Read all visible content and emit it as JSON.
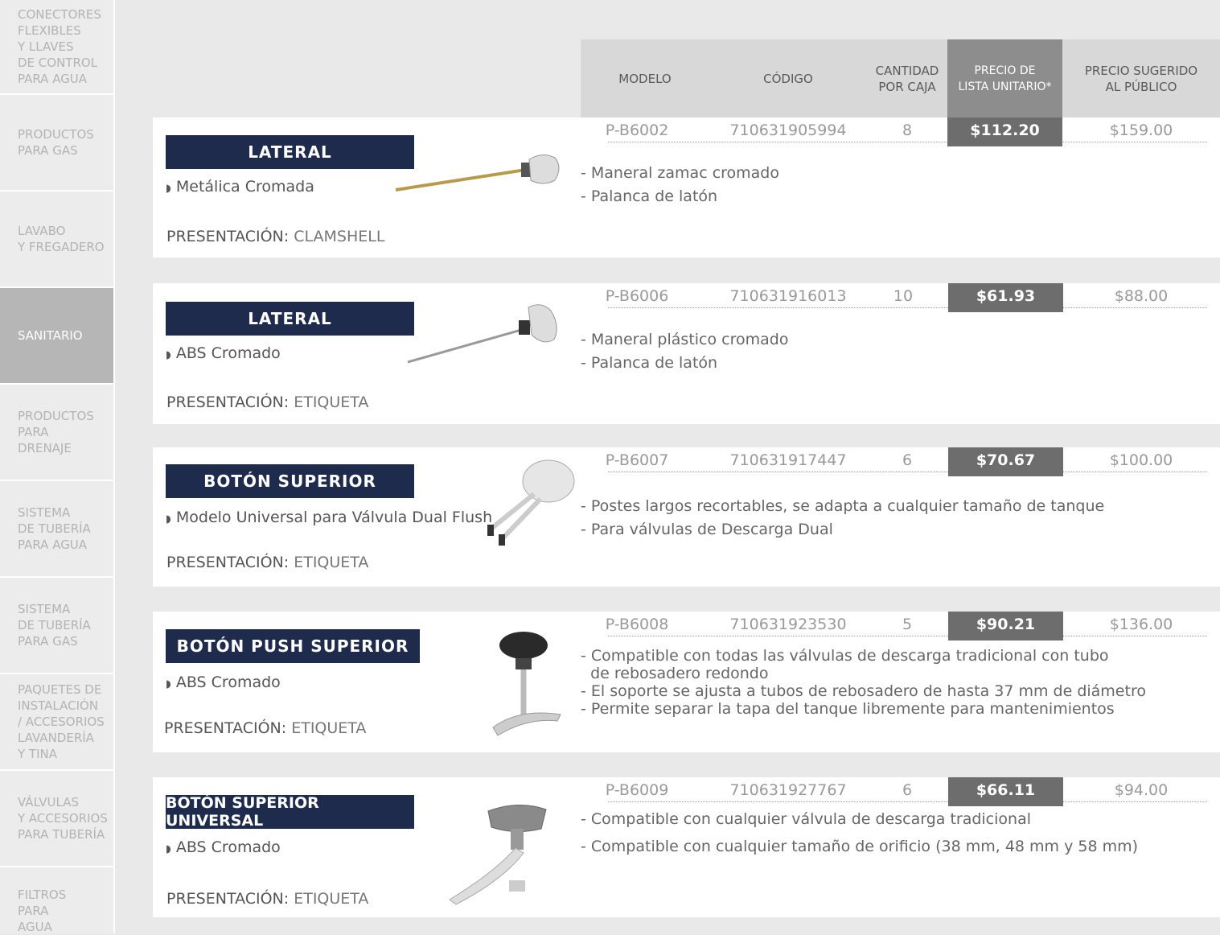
{
  "sidebar": {
    "items": [
      {
        "label": "CONECTORES\nFLEXIBLES\nY LLAVES\nDE CONTROL\nPARA AGUA",
        "active": false
      },
      {
        "label": "PRODUCTOS\nPARA GAS",
        "active": false
      },
      {
        "label": "LAVABO\nY FREGADERO",
        "active": false
      },
      {
        "label": "SANITARIO",
        "active": true
      },
      {
        "label": "PRODUCTOS\nPARA\nDRENAJE",
        "active": false
      },
      {
        "label": "SISTEMA\nDE TUBERÍA\nPARA AGUA",
        "active": false
      },
      {
        "label": "SISTEMA\nDE TUBERÍA\nPARA GAS",
        "active": false
      },
      {
        "label": "PAQUETES DE\nINSTALACIÓN\n/ ACCESORIOS\nLAVANDERÍA\nY TINA",
        "active": false
      },
      {
        "label": "VÁLVULAS\nY ACCESORIOS\nPARA TUBERÍA",
        "active": false
      },
      {
        "label": "FILTROS\nPARA\nAGUA",
        "active": false
      }
    ]
  },
  "table_header": {
    "modelo": "MODELO",
    "codigo": "CÓDIGO",
    "cantidad": "CANTIDAD\nPOR CAJA",
    "precio_lista": "PRECIO DE\nLISTA UNITARIO*",
    "precio_sugerido": "PRECIO SUGERIDO\nAL PÚBLICO"
  },
  "presentation_label": "PRESENTACIÓN: ",
  "products": [
    {
      "category": "LATERAL",
      "subtitle": "Metálica Cromada",
      "presentation": "CLAMSHELL",
      "modelo": "P-B6002",
      "codigo": "710631905994",
      "cantidad": "8",
      "precio_lista": "$112.20",
      "precio_sugerido": "$159.00",
      "features": "- Maneral zamac cromado\n- Palanca de latón"
    },
    {
      "category": "LATERAL",
      "subtitle": "ABS Cromado",
      "presentation": "ETIQUETA",
      "modelo": "P-B6006",
      "codigo": "710631916013",
      "cantidad": "10",
      "precio_lista": "$61.93",
      "precio_sugerido": "$88.00",
      "features": "- Maneral plástico cromado\n- Palanca de latón"
    },
    {
      "category": "BOTÓN SUPERIOR",
      "subtitle": "Modelo Universal para Válvula Dual Flush",
      "presentation": "ETIQUETA",
      "modelo": "P-B6007",
      "codigo": "710631917447",
      "cantidad": "6",
      "precio_lista": "$70.67",
      "precio_sugerido": "$100.00",
      "features": "- Postes largos recortables, se adapta a cualquier tamaño de tanque\n- Para válvulas de Descarga Dual"
    },
    {
      "category": "BOTÓN PUSH SUPERIOR",
      "subtitle": "ABS Cromado",
      "presentation": "ETIQUETA",
      "modelo": "P-B6008",
      "codigo": "710631923530",
      "cantidad": "5",
      "precio_lista": "$90.21",
      "precio_sugerido": "$136.00",
      "features": "- Compatible con todas las válvulas de descarga tradicional con tubo\n  de rebosadero redondo\n- El soporte se ajusta a tubos de rebosadero de hasta 37 mm de diámetro\n- Permite separar la tapa del tanque libremente para mantenimientos"
    },
    {
      "category": "BOTÓN SUPERIOR UNIVERSAL",
      "subtitle": "ABS Cromado",
      "presentation": "ETIQUETA",
      "modelo": "P-B6009",
      "codigo": "710631927767",
      "cantidad": "6",
      "precio_lista": "$66.11",
      "precio_sugerido": "$94.00",
      "features": "- Compatible con cualquier válvula de descarga tradicional\n\n- Compatible con cualquier tamaño de orificio (38 mm, 48 mm y 58 mm)"
    }
  ],
  "colors": {
    "category_bg": "#1e2b4d",
    "price_bg": "#6d6d6d",
    "header_bg": "#d8d8d8",
    "header_dark": "#8d8d8d",
    "sidebar_active": "#b6b6b6"
  }
}
